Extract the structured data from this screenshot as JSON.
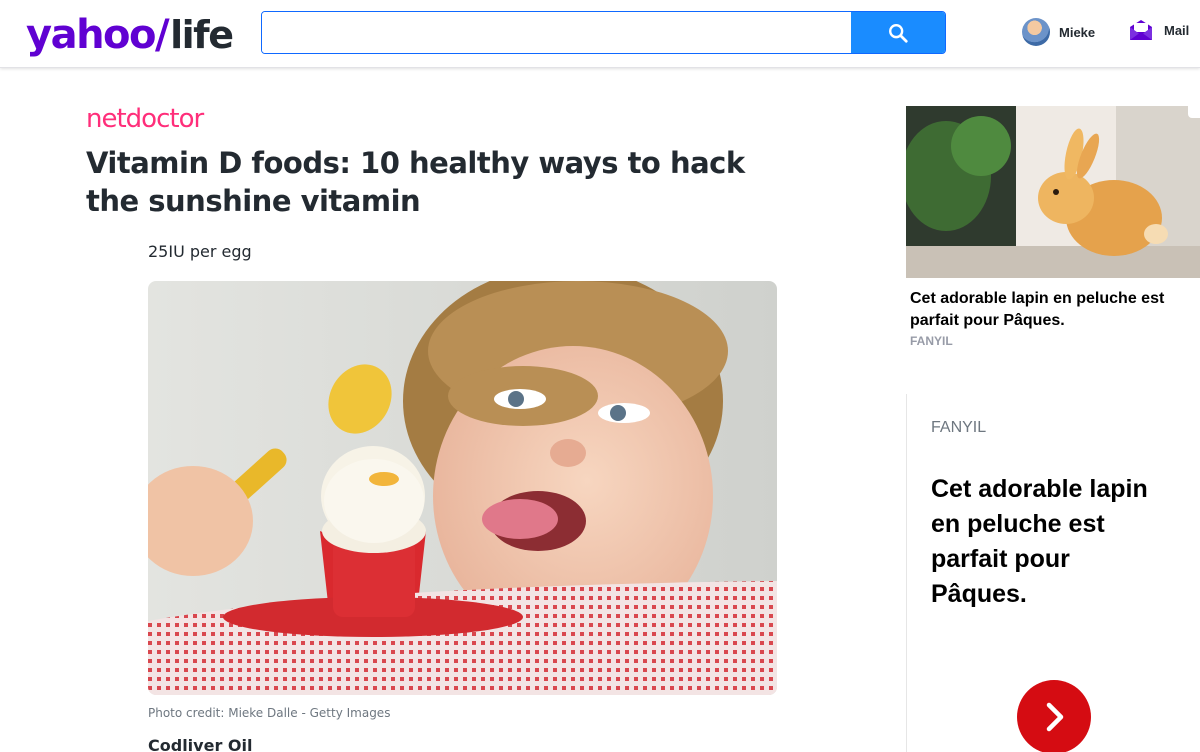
{
  "header": {
    "logo_brand": "yahoo",
    "logo_slash": "/",
    "logo_section": "life",
    "search": {
      "value": "",
      "placeholder": ""
    },
    "user_name": "Mieke",
    "mail_label": "Mail"
  },
  "article": {
    "publisher": "netdoctor",
    "title": "Vitamin D foods: 10 healthy ways to hack the sunshine vitamin",
    "paragraph": "25IU per egg",
    "photo_credit": "Photo credit: Mieke Dalle - Getty Images",
    "next_subhead": "Codliver Oil"
  },
  "ads": {
    "ad1": {
      "title": "Cet adorable lapin en peluche est parfait pour Pâques.",
      "sponsor": "FANYIL"
    },
    "ad2": {
      "sponsor": "FANYIL",
      "headline": "Cet adorable lapin en peluche est parfait pour Pâques."
    }
  },
  "colors": {
    "yahoo_purple": "#6001d2",
    "search_blue": "#1a8cff",
    "netdoctor_pink": "#ff2e7a",
    "cta_red": "#d50c12"
  },
  "icons": [
    "search-icon",
    "mail-icon",
    "chevron-right-icon",
    "adchoices-icon"
  ]
}
